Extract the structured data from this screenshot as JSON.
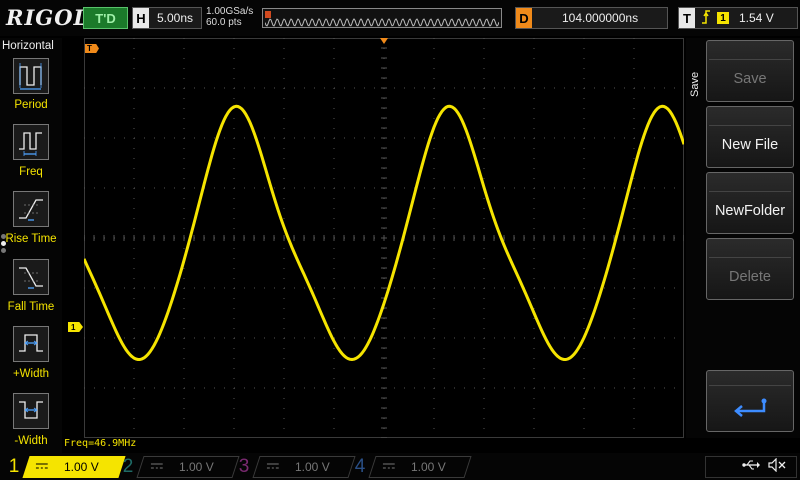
{
  "top_bar": {
    "logo": "RIGOL",
    "trigger_status": "T'D",
    "timebase_letter": "H",
    "timebase": "5.00ns",
    "sample_rate": "1.00GSa/s",
    "memory_depth": "60.0 pts",
    "delay_letter": "D",
    "delay": "104.000000ns",
    "trigger_letter": "T",
    "trigger_edge": "rising-edge-icon",
    "trigger_source": "1",
    "trigger_level": "1.54 V"
  },
  "left_menu": {
    "title": "Horizontal",
    "items": [
      {
        "label": "Period",
        "icon": "period-icon"
      },
      {
        "label": "Freq",
        "icon": "freq-icon"
      },
      {
        "label": "Rise Time",
        "icon": "rise-time-icon"
      },
      {
        "label": "Fall Time",
        "icon": "fall-time-icon"
      },
      {
        "label": "+Width",
        "icon": "positive-width-icon"
      },
      {
        "label": "-Width",
        "icon": "negative-width-icon"
      }
    ]
  },
  "waveform": {
    "color": "#f5e400",
    "trace": "sine-like waveform ~46.9MHz, slight asymmetry",
    "freq_readout": "Freq=46.9MHz",
    "trigger_marker": "T",
    "channel_marker": "1"
  },
  "right_menu": {
    "title": "Save",
    "buttons": [
      {
        "label": "Save",
        "enabled": false
      },
      {
        "label": "New File",
        "enabled": true
      },
      {
        "label": "NewFolder",
        "enabled": true
      },
      {
        "label": "Delete",
        "enabled": false
      }
    ],
    "return_icon": "return-arrow-icon"
  },
  "channels": [
    {
      "num": "1",
      "coupling": "DC",
      "scale": "1.00 V",
      "active": true,
      "color": "#f5e400"
    },
    {
      "num": "2",
      "coupling": "DC",
      "scale": "1.00 V",
      "active": false,
      "color": "#1f6b66"
    },
    {
      "num": "3",
      "coupling": "DC",
      "scale": "1.00 V",
      "active": false,
      "color": "#7a2a70"
    },
    {
      "num": "4",
      "coupling": "DC",
      "scale": "1.00 V",
      "active": false,
      "color": "#2a4f86"
    }
  ],
  "status_icons": [
    "usb-icon",
    "speaker-muted-icon"
  ]
}
